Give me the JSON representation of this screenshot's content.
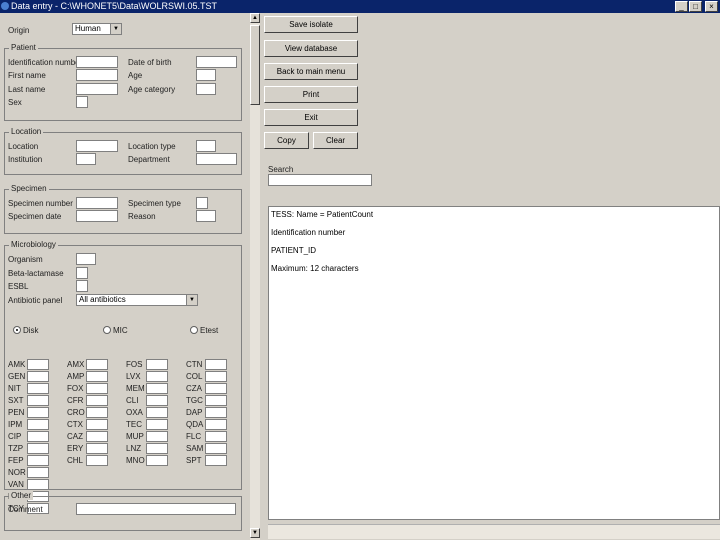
{
  "window": {
    "title": "Data entry - C:\\WHONET5\\Data\\WOLRSWI.05.TST"
  },
  "left": {
    "origin_label": "Origin",
    "origin_value": "Human",
    "patient": {
      "title": "Patient",
      "fields": [
        {
          "label": "Identification number"
        },
        {
          "label": "First name"
        },
        {
          "label": "Last name"
        },
        {
          "label": "Sex"
        },
        {
          "label": "Date of birth"
        },
        {
          "label": "Age"
        },
        {
          "label": "Age category"
        }
      ]
    },
    "location": {
      "title": "Location",
      "fields": [
        {
          "label": "Location"
        },
        {
          "label": "Institution"
        },
        {
          "label": "Location type"
        },
        {
          "label": "Department"
        }
      ]
    },
    "specimen": {
      "title": "Specimen",
      "fields": [
        {
          "label": "Specimen number"
        },
        {
          "label": "Specimen date"
        },
        {
          "label": "Specimen type"
        },
        {
          "label": "Reason"
        }
      ]
    },
    "microbiology": {
      "title": "Microbiology",
      "fields": [
        {
          "label": "Organism"
        },
        {
          "label": "Beta-lactamase"
        },
        {
          "label": "ESBL"
        },
        {
          "label": "Antibiotic panel"
        }
      ],
      "panel_value": "All antibiotics",
      "test_methods": [
        "Disk",
        "MIC",
        "Etest"
      ],
      "antibiotics": [
        [
          "AMK",
          "GEN",
          "NIT",
          "SXT",
          "PEN",
          "IPM",
          "CIP",
          "TZP",
          "FEP",
          "NOR",
          "VAN",
          "RIF",
          "TCY"
        ],
        [
          "AMX",
          "AMP",
          "FOX",
          "CFR",
          "CRO",
          "CTX",
          "CAZ",
          "ERY",
          "CHL"
        ],
        [
          "FOS",
          "LVX",
          "MEM",
          "CLI",
          "OXA",
          "TEC",
          "MUP",
          "LNZ",
          "MNO"
        ],
        [
          "CTN",
          "COL",
          "CZA",
          "TGC",
          "DAP",
          "QDA",
          "FLC",
          "SAM",
          "SPT"
        ]
      ]
    },
    "other": {
      "title": "Other",
      "comment_label": "Comment"
    }
  },
  "right": {
    "buttons": {
      "save_isolate": "Save isolate",
      "view_database": "View database",
      "back_to_main": "Back to main menu",
      "print": "Print",
      "exit": "Exit",
      "copy": "Copy",
      "clear": "Clear"
    },
    "search_label": "Search",
    "help_lines": [
      "TESS: Name = PatientCount",
      "",
      "Identification number",
      "",
      "PATIENT_ID",
      "",
      "Maximum: 12 characters"
    ]
  },
  "colors": {
    "titlebar": "#0a246a",
    "face": "#d4d0c8"
  }
}
